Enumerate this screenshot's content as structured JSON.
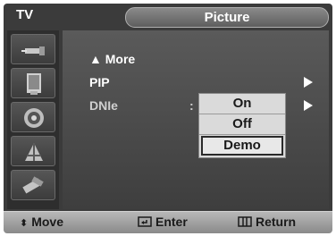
{
  "header": {
    "left_label": "TV",
    "title": "Picture"
  },
  "sidebar": {
    "icons": [
      {
        "name": "input-source-icon"
      },
      {
        "name": "picture-icon"
      },
      {
        "name": "sound-icon"
      },
      {
        "name": "channel-icon"
      },
      {
        "name": "setup-icon"
      }
    ]
  },
  "menu": {
    "more_label": "▲ More",
    "items": [
      {
        "label": "PIP",
        "has_arrow": true
      },
      {
        "label": "DNIe",
        "has_arrow": true,
        "separator": ":"
      }
    ]
  },
  "dropdown": {
    "options": [
      {
        "label": "On",
        "selected": false
      },
      {
        "label": "Off",
        "selected": false
      },
      {
        "label": "Demo",
        "selected": true
      }
    ]
  },
  "footer": {
    "move_label": "Move",
    "enter_label": "Enter",
    "return_label": "Return"
  },
  "colors": {
    "background": "#3b3b3b",
    "footer": "#a0a0a0",
    "dropdown": "#dadada",
    "text": "#ffffff"
  }
}
